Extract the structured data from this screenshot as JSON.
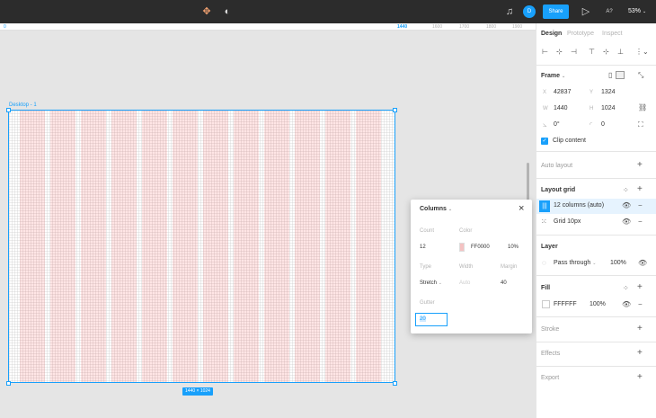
{
  "topbar": {
    "avatar_initials": "D",
    "share_label": "Share",
    "zoom_label": "53%",
    "aa_label": "A?"
  },
  "ruler": {
    "highlight": "1440",
    "ticks": [
      "1440",
      "1600",
      "1700",
      "1800",
      "1900"
    ]
  },
  "canvas": {
    "frame_name": "Desktop - 1",
    "frame_size": "1440 × 1024"
  },
  "columns_popover": {
    "title": "Columns",
    "count_label": "Count",
    "count_value": "12",
    "color_label": "Color",
    "color_hex": "FF0000",
    "color_opacity": "10%",
    "swatch_color": "#f4c2c2",
    "type_label": "Type",
    "type_value": "Stretch",
    "width_label": "Width",
    "width_value": "Auto",
    "margin_label": "Margin",
    "margin_value": "40",
    "gutter_label": "Gutter",
    "gutter_value": "20"
  },
  "panel": {
    "tabs": [
      "Design",
      "Prototype",
      "Inspect"
    ],
    "frame": {
      "title": "Frame",
      "x_label": "X",
      "x": "42837",
      "y_label": "Y",
      "y": "1324",
      "w_label": "W",
      "w": "1440",
      "h_label": "H",
      "h": "1024",
      "rotation": "0°",
      "radius": "0",
      "clip_content": "Clip content"
    },
    "auto_layout": "Auto layout",
    "layout_grid": {
      "title": "Layout grid",
      "items": [
        "12 columns (auto)",
        "Grid 10px"
      ]
    },
    "layer": {
      "title": "Layer",
      "blend": "Pass through",
      "opacity": "100%"
    },
    "fill": {
      "title": "Fill",
      "hex": "FFFFFF",
      "opacity": "100%"
    },
    "stroke": "Stroke",
    "effects": "Effects",
    "export": "Export"
  },
  "colors": {
    "accent": "#18a0fb",
    "grid_column": "#ffcccc"
  }
}
